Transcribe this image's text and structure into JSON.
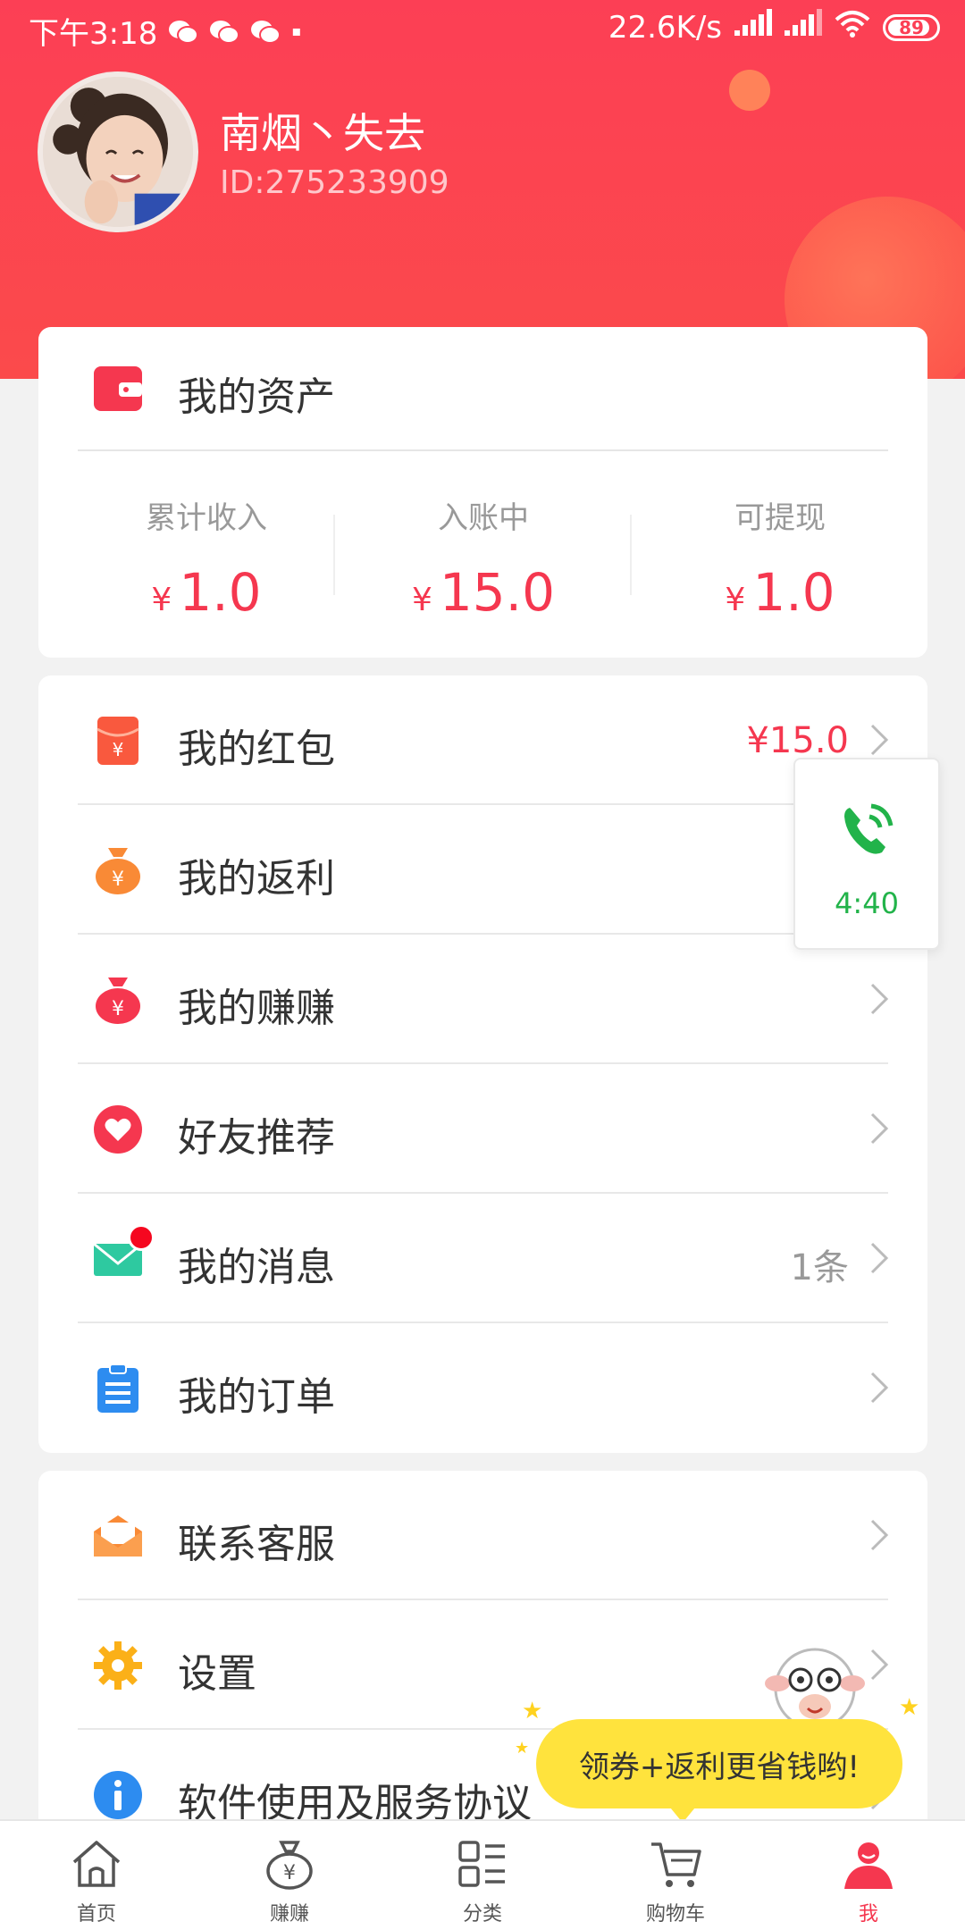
{
  "status_bar": {
    "time": "下午3:18",
    "network_speed": "22.6K/s",
    "battery": "89",
    "battery_level": 0.89,
    "icons": [
      "wechat-icon",
      "wechat-icon",
      "wechat-icon",
      "notification-icon",
      "signal-icon",
      "signal-icon",
      "wifi-icon",
      "battery-icon"
    ]
  },
  "profile": {
    "name": "南烟丶失去",
    "id_text": "ID:275233909"
  },
  "assets": {
    "title": "我的资产",
    "icon": "wallet-icon",
    "stats": [
      {
        "label": "累计收入",
        "currency": "¥",
        "value": "1.0"
      },
      {
        "label": "入账中",
        "currency": "¥",
        "value": "15.0"
      },
      {
        "label": "可提现",
        "currency": "¥",
        "value": "1.0"
      }
    ]
  },
  "menu_group_1": [
    {
      "label": "我的红包",
      "icon": "red-envelope-icon",
      "extra": "¥15.0"
    },
    {
      "label": "我的返利",
      "icon": "money-bag-icon",
      "extra": ""
    },
    {
      "label": "我的赚赚",
      "icon": "money-bag-red-icon",
      "extra": ""
    },
    {
      "label": "好友推荐",
      "icon": "heart-icon",
      "extra": ""
    },
    {
      "label": "我的消息",
      "icon": "mail-icon",
      "extra": "1条"
    },
    {
      "label": "我的订单",
      "icon": "clipboard-icon",
      "extra": ""
    }
  ],
  "menu_group_2": [
    {
      "label": "联系客服",
      "icon": "open-mail-icon"
    },
    {
      "label": "设置",
      "icon": "gear-icon"
    },
    {
      "label": "软件使用及服务协议",
      "icon": "info-icon"
    }
  ],
  "call_float": {
    "time": "4:40",
    "icon": "phone-call-icon"
  },
  "promo": {
    "text": "领券+返利更省钱哟!"
  },
  "tabs": [
    {
      "label": "首页",
      "icon": "home-icon"
    },
    {
      "label": "赚赚",
      "icon": "money-bag-outline-icon"
    },
    {
      "label": "分类",
      "icon": "category-icon"
    },
    {
      "label": "购物车",
      "icon": "cart-icon"
    },
    {
      "label": "我",
      "icon": "user-icon",
      "active": true
    }
  ],
  "colors": {
    "brand_red": "#fc3f55",
    "price_red": "#f5374f",
    "call_green": "#22b34a",
    "promo_yellow": "#ffe33d"
  }
}
